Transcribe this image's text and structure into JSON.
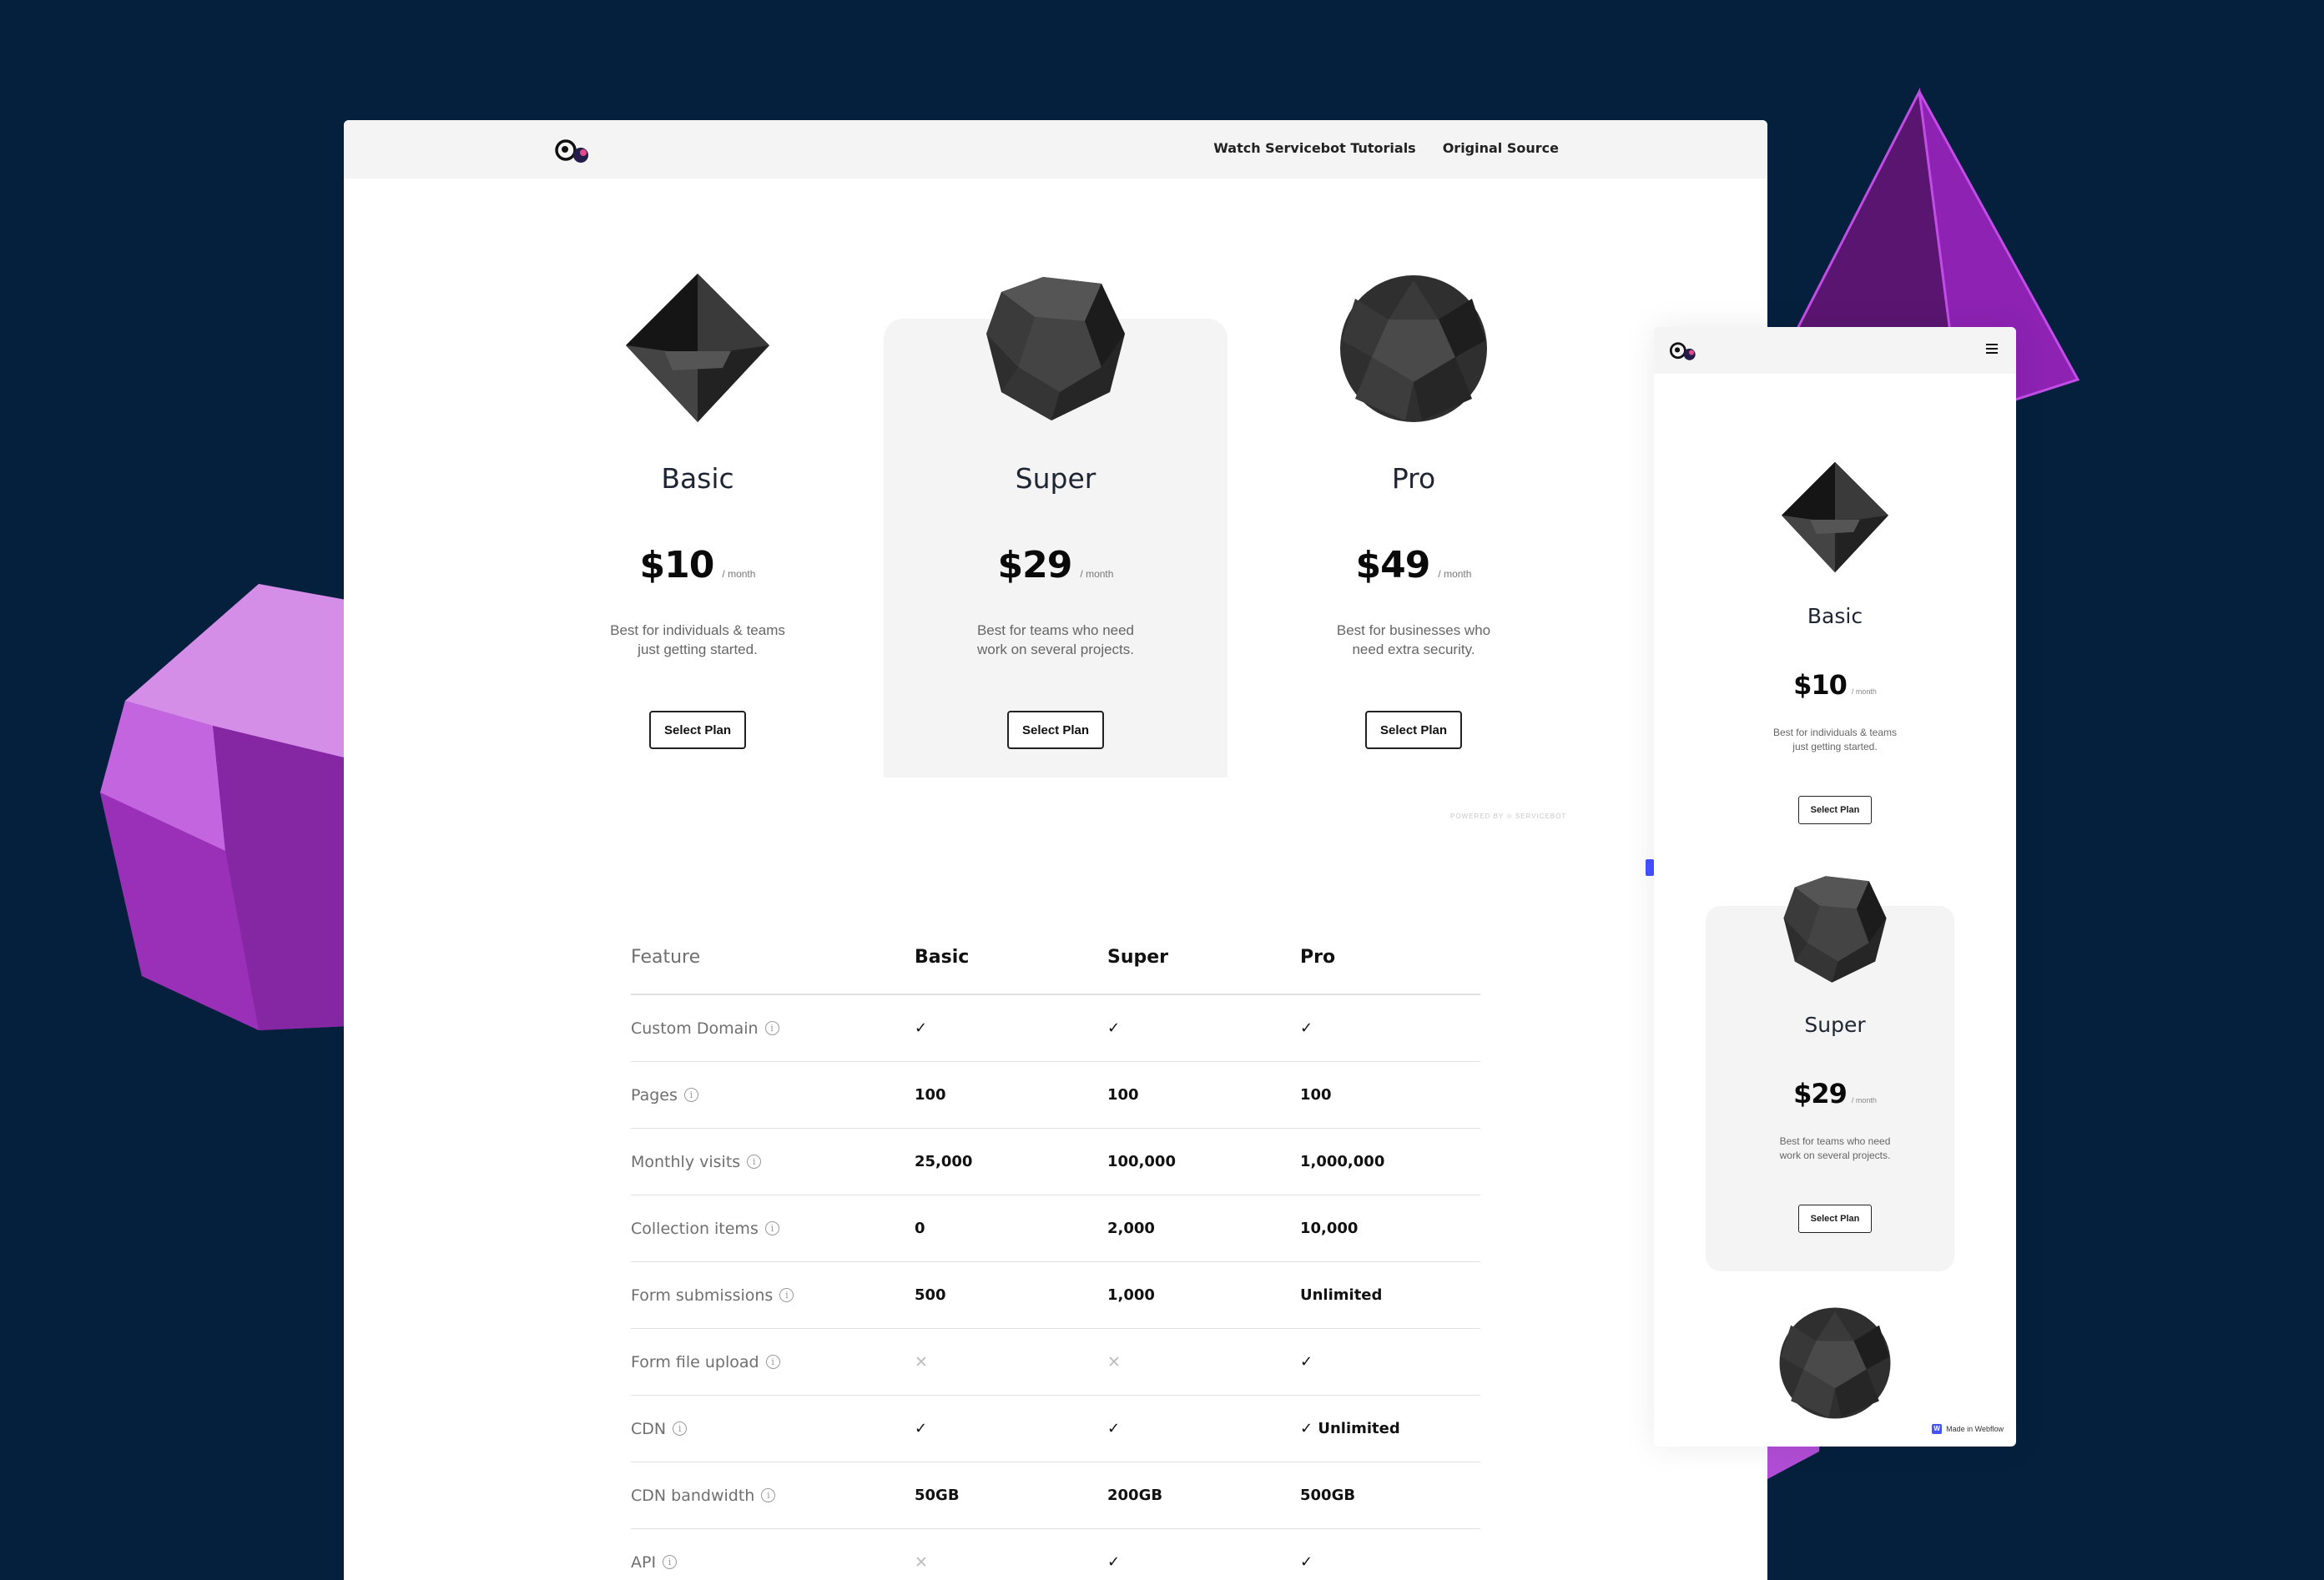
{
  "nav": {
    "links": [
      "Watch Servicebot Tutorials",
      "Original Source"
    ]
  },
  "plans": [
    {
      "name": "Basic",
      "price": "$10",
      "period": "/ month",
      "desc_line1": "Best for individuals & teams",
      "desc_line2": "just getting started.",
      "button": "Select Plan",
      "gem": "octahedron-gem-icon"
    },
    {
      "name": "Super",
      "price": "$29",
      "period": "/ month",
      "desc_line1": "Best for teams who need",
      "desc_line2": "work on several projects.",
      "button": "Select Plan",
      "gem": "dodecahedron-gem-icon"
    },
    {
      "name": "Pro",
      "price": "$49",
      "period": "/ month",
      "desc_line1": "Best for businesses who",
      "desc_line2": "need extra security.",
      "button": "Select Plan",
      "gem": "polyhedron-gem-icon"
    }
  ],
  "powered_by": "POWERED BY ⟐ SERVICEBOT",
  "features": {
    "headers": [
      "Feature",
      "Basic",
      "Super",
      "Pro"
    ],
    "rows": [
      {
        "name": "Custom Domain",
        "basic": "✓",
        "super": "✓",
        "pro": "✓"
      },
      {
        "name": "Pages",
        "basic": "100",
        "super": "100",
        "pro": "100"
      },
      {
        "name": "Monthly visits",
        "basic": "25,000",
        "super": "100,000",
        "pro": "1,000,000"
      },
      {
        "name": "Collection items",
        "basic": "0",
        "super": "2,000",
        "pro": "10,000"
      },
      {
        "name": "Form submissions",
        "basic": "500",
        "super": "1,000",
        "pro": "Unlimited"
      },
      {
        "name": "Form file upload",
        "basic": "✕",
        "super": "✕",
        "pro": "✓"
      },
      {
        "name": "CDN",
        "basic": "✓",
        "super": "✓",
        "pro": "✓ Unlimited"
      },
      {
        "name": "CDN bandwidth",
        "basic": "50GB",
        "super": "200GB",
        "pro": "500GB"
      },
      {
        "name": "API",
        "basic": "✕",
        "super": "✓",
        "pro": "✓"
      }
    ],
    "info_glyph": "i"
  },
  "mobile": {
    "made_in_webflow": "Made in Webflow",
    "webflow_badge": "W"
  },
  "colors": {
    "background": "#04203d",
    "accent_gem": "#b33ad6",
    "highlight_card": "#f4f4f4"
  }
}
